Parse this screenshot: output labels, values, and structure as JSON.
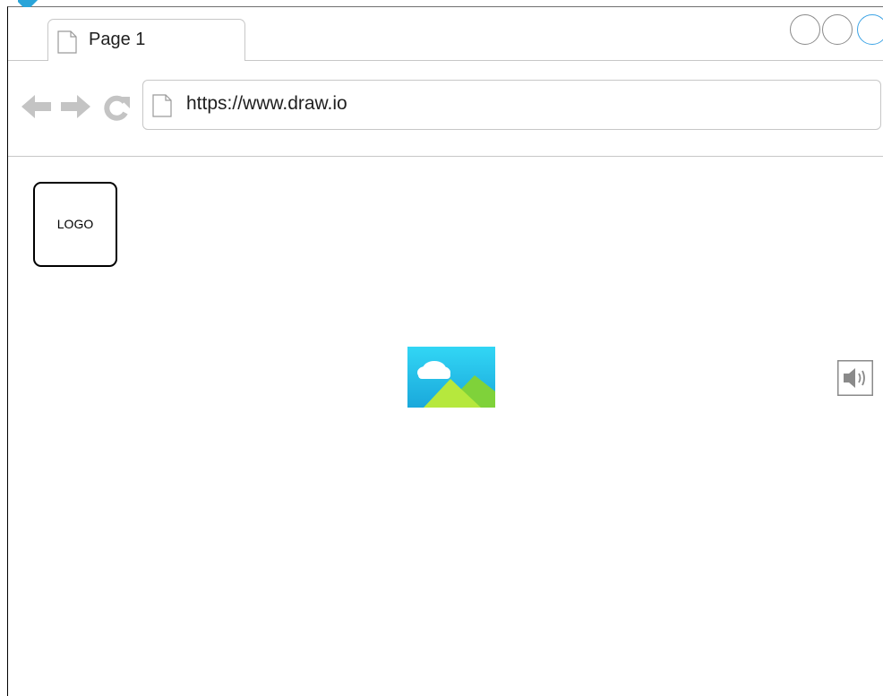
{
  "tab": {
    "label": "Page 1",
    "icon": "document-icon"
  },
  "window_controls": [
    "circle-button",
    "circle-button",
    "circle-button-active"
  ],
  "toolbar": {
    "back_icon": "arrow-left-icon",
    "forward_icon": "arrow-right-icon",
    "reload_icon": "reload-icon",
    "url": "https://www.draw.io",
    "url_icon": "document-icon"
  },
  "content": {
    "logo_label": "LOGO",
    "image_icon": "image-placeholder-icon",
    "speaker_icon": "speaker-icon"
  },
  "colors": {
    "accent": "#3ba3e5",
    "image_sky": "#2fd0f0",
    "image_hill": "#a6e23a",
    "icon_gray": "#c4c4c4"
  }
}
